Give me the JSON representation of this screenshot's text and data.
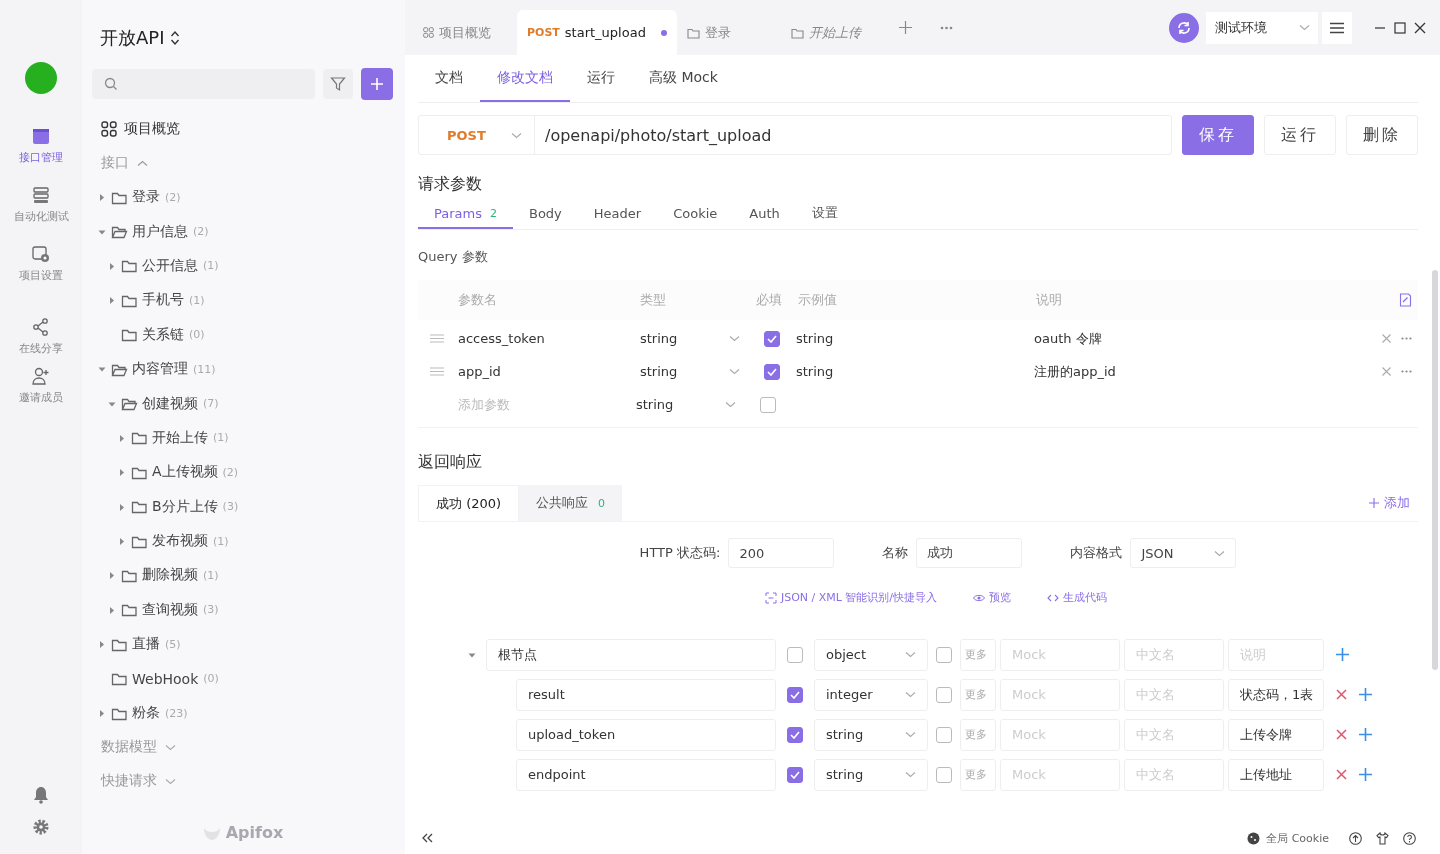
{
  "rail": {
    "items": [
      {
        "kind": "api",
        "label": "接口管理",
        "selected": true
      },
      {
        "kind": "test",
        "label": "自动化测试",
        "selected": false
      },
      {
        "kind": "settings",
        "label": "项目设置",
        "selected": false
      },
      {
        "kind": "share",
        "label": "在线分享",
        "selected": false
      },
      {
        "kind": "invite",
        "label": "邀请成员",
        "selected": false
      }
    ]
  },
  "sidebar": {
    "project_title": "开放API",
    "overview": "项目概览",
    "section": "接口",
    "section_expanded": true,
    "tree": [
      {
        "label": "登录",
        "count": "(2)",
        "expanded": false
      },
      {
        "label": "用户信息",
        "count": "(2)",
        "expanded": true,
        "children": [
          {
            "label": "公开信息",
            "count": "(1)",
            "expanded": false
          },
          {
            "label": "手机号",
            "count": "(1)",
            "expanded": false
          },
          {
            "label": "关系链",
            "count": "(0)"
          }
        ]
      },
      {
        "label": "内容管理",
        "count": "(11)",
        "expanded": true,
        "children": [
          {
            "label": "创建视频",
            "count": "(7)",
            "expanded": true,
            "children": [
              {
                "label": "开始上传",
                "count": "(1)",
                "expanded": false
              },
              {
                "label": "A上传视频",
                "count": "(2)",
                "expanded": false
              },
              {
                "label": "B分片上传",
                "count": "(3)",
                "expanded": false
              },
              {
                "label": "发布视频",
                "count": "(1)",
                "expanded": false
              }
            ]
          },
          {
            "label": "删除视频",
            "count": "(1)",
            "expanded": false
          },
          {
            "label": "查询视频",
            "count": "(3)",
            "expanded": false
          }
        ]
      },
      {
        "label": "直播",
        "count": "(5)",
        "expanded": false
      },
      {
        "label": "WebHook",
        "count": "(0)"
      },
      {
        "label": "粉条",
        "count": "(23)",
        "expanded": false
      }
    ],
    "collapsed_sections": [
      "数据模型",
      "快捷请求"
    ],
    "brand": "Apifox"
  },
  "tabs": [
    {
      "kind": "overview",
      "label": "项目概览",
      "selected": false
    },
    {
      "kind": "api",
      "method": "POST",
      "label": "start_upload",
      "selected": true,
      "unsaved": true
    },
    {
      "kind": "folder",
      "label": "登录",
      "selected": false,
      "preview": false
    },
    {
      "kind": "folder",
      "label": "开始上传",
      "selected": false,
      "preview": true
    }
  ],
  "environment": "测试环境",
  "view_tabs": [
    {
      "label": "文档",
      "selected": false
    },
    {
      "label": "修改文档",
      "selected": true
    },
    {
      "label": "运行",
      "selected": false
    },
    {
      "label": "高级 Mock",
      "selected": false
    }
  ],
  "request": {
    "method": "POST",
    "path": "/openapi/photo/start_upload",
    "buttons": [
      {
        "kind": "primary",
        "label": "保存"
      },
      {
        "kind": "plain",
        "label": "运行"
      },
      {
        "kind": "plain",
        "label": "删除"
      }
    ]
  },
  "params": {
    "title": "请求参数",
    "tabs": [
      {
        "label": "Params",
        "count": "2",
        "selected": true
      },
      {
        "label": "Body",
        "selected": false
      },
      {
        "label": "Header",
        "selected": false
      },
      {
        "label": "Cookie",
        "selected": false
      },
      {
        "label": "Auth",
        "selected": false
      },
      {
        "label": "设置",
        "selected": false
      }
    ],
    "query_title": "Query 参数",
    "columns": [
      "参数名",
      "类型",
      "必填",
      "示例值",
      "说明"
    ],
    "rows": [
      {
        "name": "access_token",
        "type": "string",
        "required": true,
        "example": "string",
        "description": "oauth 令牌"
      },
      {
        "name": "app_id",
        "type": "string",
        "required": true,
        "example": "string",
        "description": "注册的app_id"
      }
    ],
    "new_row": {
      "placeholder": "添加参数",
      "type": "string",
      "required": false
    }
  },
  "response": {
    "title": "返回响应",
    "tabs": [
      {
        "label": "成功 (200)",
        "selected": true
      },
      {
        "label": "公共响应",
        "count": "0",
        "selected": false
      }
    ],
    "add": "添加",
    "fields": [
      {
        "label": "HTTP 状态码:",
        "value": "200",
        "kind": "input"
      },
      {
        "label": "名称",
        "value": "成功",
        "kind": "input"
      },
      {
        "label": "内容格式",
        "value": "JSON",
        "kind": "select"
      }
    ],
    "actions": [
      {
        "kind": "import",
        "label": "JSON / XML 智能识别/快捷导入"
      },
      {
        "kind": "preview",
        "label": "预览"
      },
      {
        "kind": "code",
        "label": "生成代码"
      }
    ],
    "schema": [
      {
        "name": "根节点",
        "required": false,
        "type": "object",
        "nullable": false,
        "more": "更多",
        "mock": "Mock",
        "cn_name": "中文名",
        "description_placeholder": "说明",
        "expanded": true,
        "removable": false
      },
      {
        "name": "result",
        "required": true,
        "type": "integer",
        "nullable": false,
        "more": "更多",
        "mock": "Mock",
        "cn_name": "中文名",
        "description": "状态码，1表",
        "removable": true
      },
      {
        "name": "upload_token",
        "required": true,
        "type": "string",
        "nullable": false,
        "more": "更多",
        "mock": "Mock",
        "cn_name": "中文名",
        "description": "上传令牌",
        "removable": true
      },
      {
        "name": "endpoint",
        "required": true,
        "type": "string",
        "nullable": false,
        "more": "更多",
        "mock": "Mock",
        "cn_name": "中文名",
        "description": "上传地址",
        "removable": true
      }
    ]
  },
  "footer": {
    "cookie": "全局 Cookie"
  }
}
